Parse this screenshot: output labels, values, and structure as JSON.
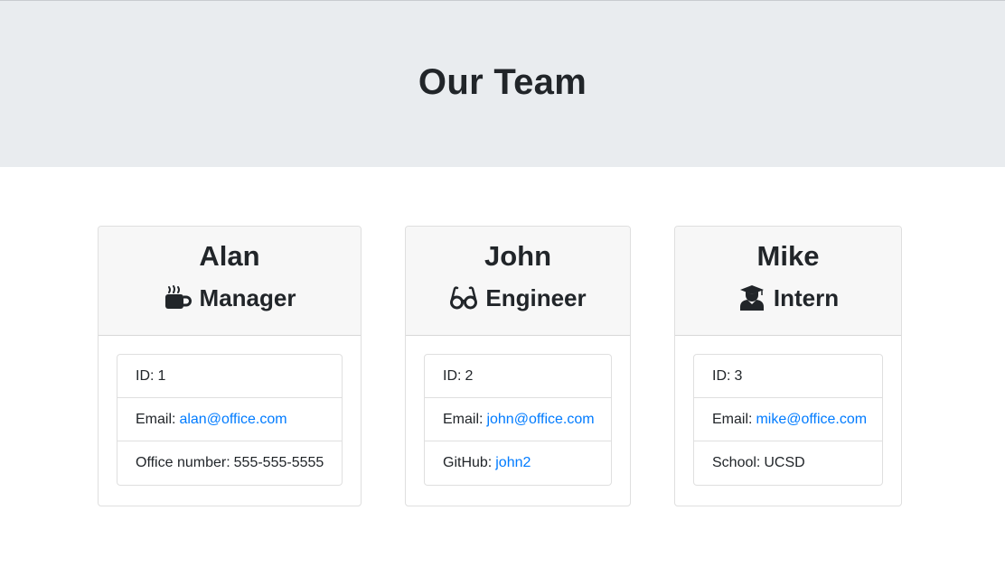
{
  "page": {
    "title": "Our Team"
  },
  "colors": {
    "header_bg": "#e9ecef",
    "card_header_bg": "#f7f7f7",
    "link": "#007bff",
    "text": "#212529"
  },
  "team": [
    {
      "name": "Alan",
      "role": "Manager",
      "role_icon": "coffee-mug-icon",
      "id_label": "ID:",
      "id_value": "1",
      "email_label": "Email:",
      "email": "alan@office.com",
      "extra_label": "Office number:",
      "extra_value": "555-555-5555"
    },
    {
      "name": "John",
      "role": "Engineer",
      "role_icon": "glasses-icon",
      "id_label": "ID:",
      "id_value": "2",
      "email_label": "Email:",
      "email": "john@office.com",
      "extra_label": "GitHub:",
      "extra_value": "john2"
    },
    {
      "name": "Mike",
      "role": "Intern",
      "role_icon": "graduate-icon",
      "id_label": "ID:",
      "id_value": "3",
      "email_label": "Email:",
      "email": "mike@office.com",
      "extra_label": "School:",
      "extra_value": "UCSD"
    }
  ]
}
